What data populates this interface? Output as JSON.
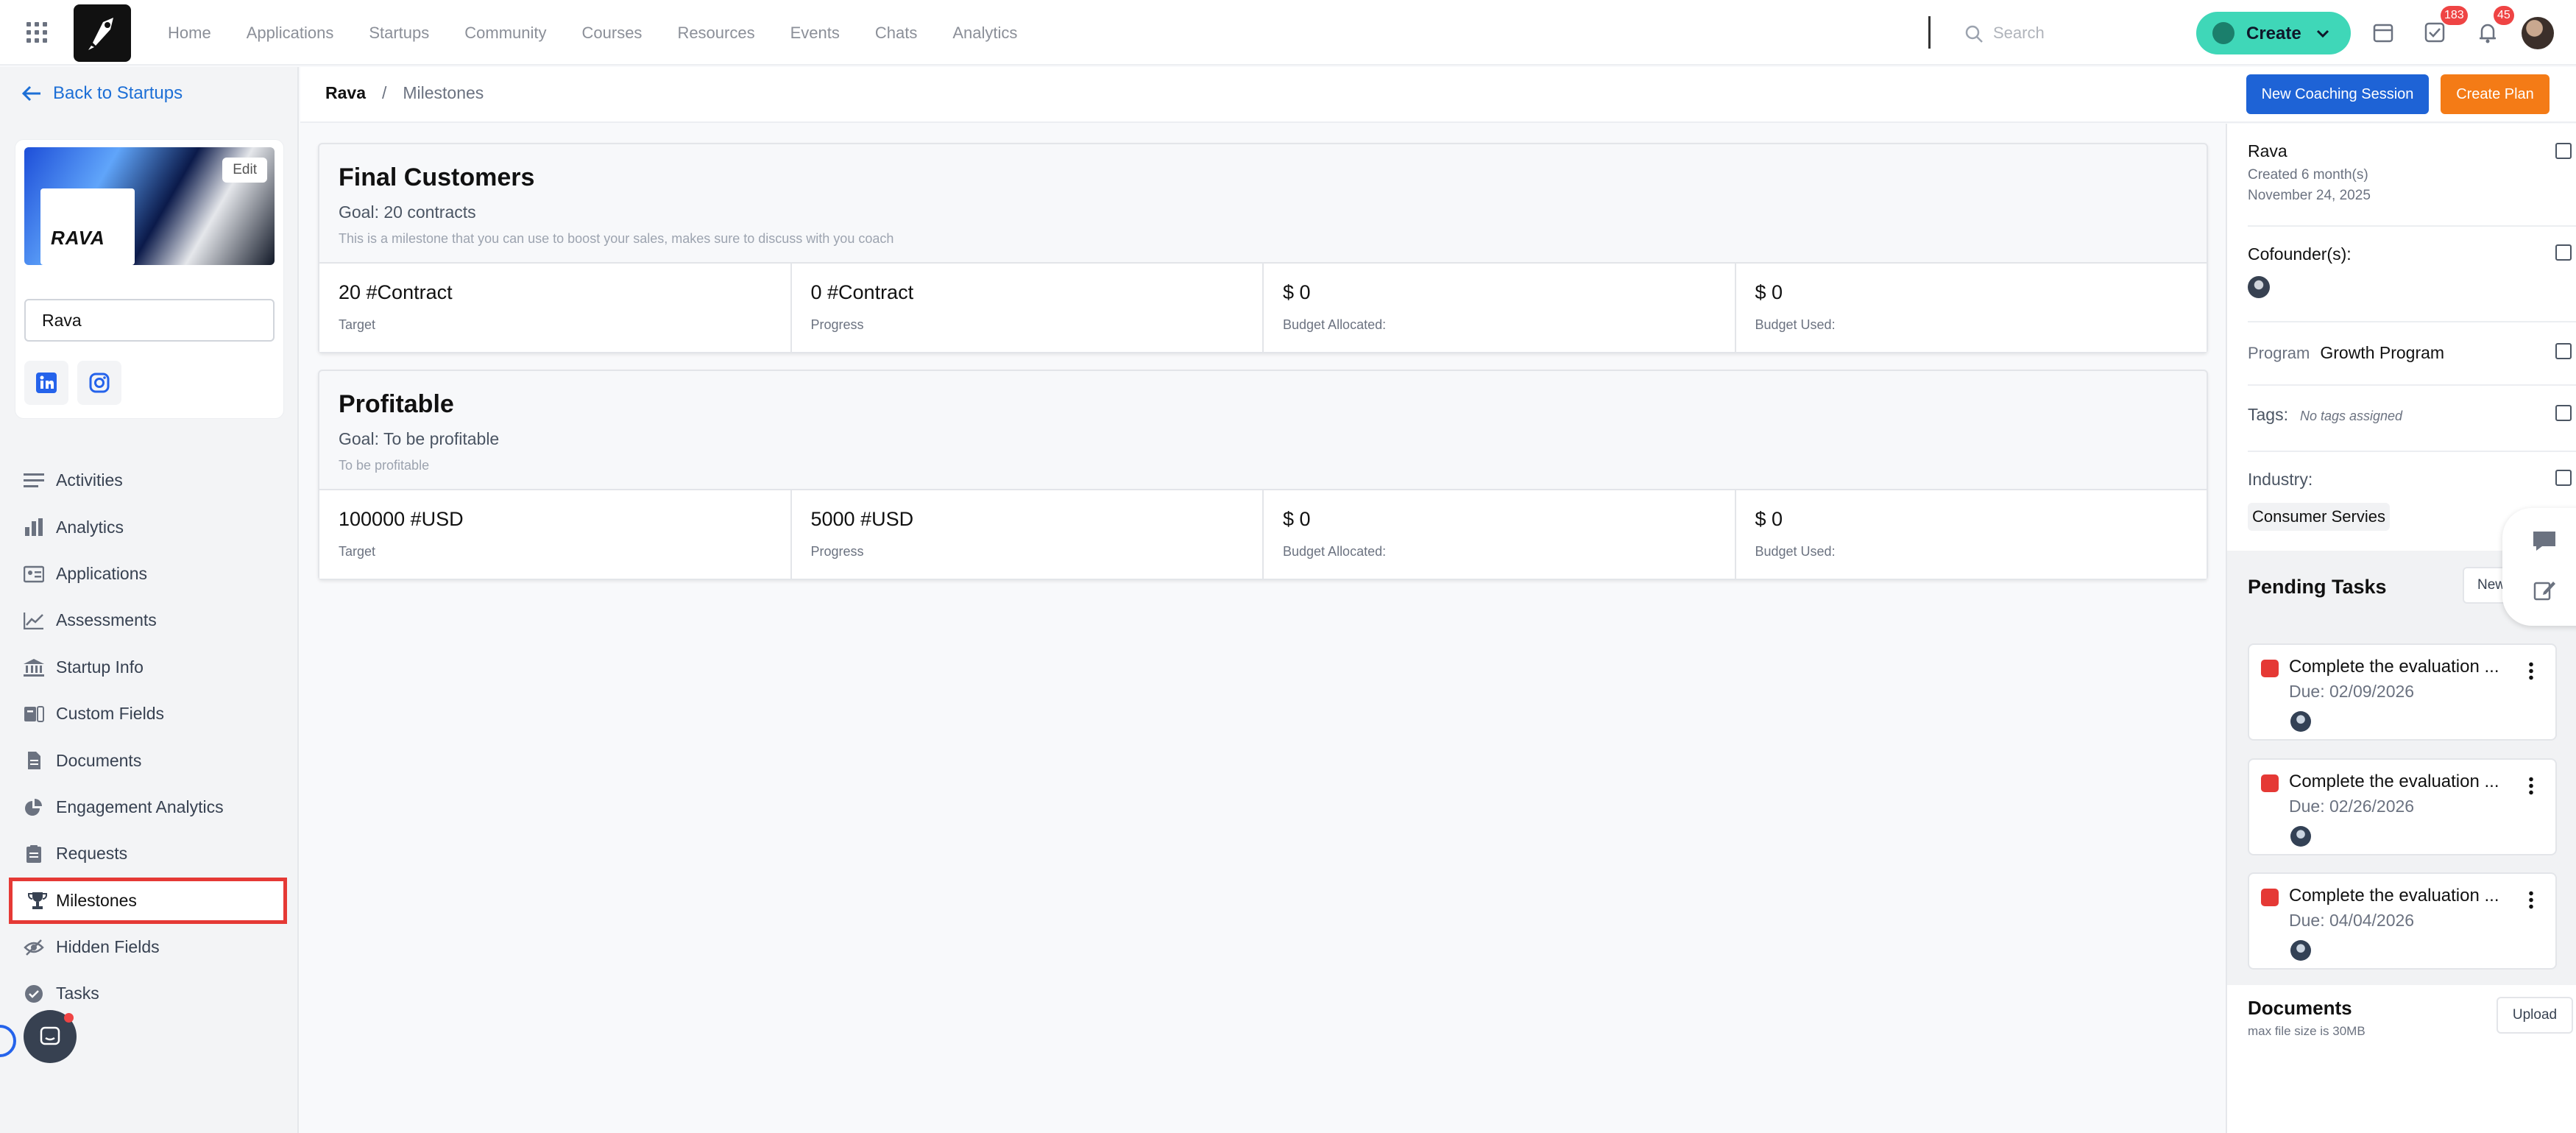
{
  "topnav": {
    "links": [
      "Home",
      "Applications",
      "Startups",
      "Community",
      "Courses",
      "Resources",
      "Events",
      "Chats",
      "Analytics"
    ],
    "search_placeholder": "Search",
    "create_label": "Create",
    "tasks_badge": "183",
    "notifications_badge": "45"
  },
  "sidebar": {
    "back_label": "Back to Startups",
    "edit_label": "Edit",
    "brand_logo_text": "RAVA",
    "startup_name": "Rava",
    "items": [
      {
        "label": "Activities",
        "icon": "list-icon"
      },
      {
        "label": "Analytics",
        "icon": "bar-chart-icon"
      },
      {
        "label": "Applications",
        "icon": "id-card-icon"
      },
      {
        "label": "Assessments",
        "icon": "line-chart-icon"
      },
      {
        "label": "Startup Info",
        "icon": "bank-icon"
      },
      {
        "label": "Custom Fields",
        "icon": "custom-field-icon"
      },
      {
        "label": "Documents",
        "icon": "document-icon"
      },
      {
        "label": "Engagement Analytics",
        "icon": "pie-chart-icon"
      },
      {
        "label": "Requests",
        "icon": "clipboard-icon"
      },
      {
        "label": "Milestones",
        "icon": "trophy-icon"
      },
      {
        "label": "Hidden Fields",
        "icon": "eye-slash-icon"
      },
      {
        "label": "Tasks",
        "icon": "check-circle-icon"
      }
    ]
  },
  "breadcrumb": {
    "root": "Rava",
    "separator": "/",
    "current": "Milestones"
  },
  "actions": {
    "coaching": "New Coaching Session",
    "plan": "Create Plan"
  },
  "milestones": [
    {
      "title": "Final Customers",
      "goal": "Goal: 20 contracts",
      "description": "This is a milestone that you can use to boost your sales, makes sure to discuss with you coach",
      "stats": [
        {
          "value": "20 #Contract",
          "label": "Target"
        },
        {
          "value": "0 #Contract",
          "label": "Progress"
        },
        {
          "value": "$ 0",
          "label": "Budget Allocated:"
        },
        {
          "value": "$ 0",
          "label": "Budget Used:"
        }
      ]
    },
    {
      "title": "Profitable",
      "goal": "Goal: To be profitable",
      "description": "To be profitable",
      "stats": [
        {
          "value": "100000 #USD",
          "label": "Target"
        },
        {
          "value": "5000 #USD",
          "label": "Progress"
        },
        {
          "value": "$ 0",
          "label": "Budget Allocated:"
        },
        {
          "value": "$ 0",
          "label": "Budget Used:"
        }
      ]
    }
  ],
  "right_panel": {
    "name": "Rava",
    "created": "Created 6 month(s)",
    "date": "November 24, 2025",
    "cofounders_label": "Cofounder(s):",
    "program_label": "Program",
    "program_value": "Growth Program",
    "tags_label": "Tags:",
    "tags_value": "No tags assigned",
    "industry_label": "Industry:",
    "industry_value": "Consumer Servies",
    "pending_title": "Pending Tasks",
    "new_label": "New",
    "tasks": [
      {
        "title": "Complete the evaluation ...",
        "due": "Due: 02/09/2026"
      },
      {
        "title": "Complete the evaluation ...",
        "due": "Due: 02/26/2026"
      },
      {
        "title": "Complete the evaluation ...",
        "due": "Due: 04/04/2026"
      }
    ],
    "documents_title": "Documents",
    "documents_sub": "max file size is 30MB",
    "upload_label": "Upload"
  },
  "colors": {
    "accent": "#1e63d6",
    "create": "#3fd7b8",
    "plan": "#f47b16",
    "highlight": "#e53935"
  }
}
